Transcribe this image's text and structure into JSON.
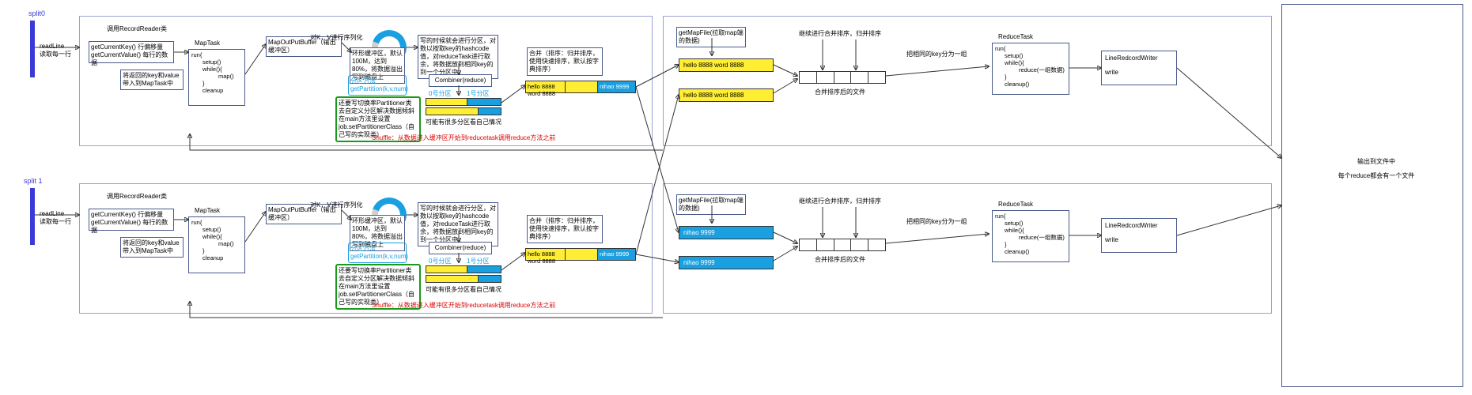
{
  "split0": {
    "label": "split0",
    "readLine1": "readLine",
    "readLine2": "读取每一行"
  },
  "split1": {
    "label": "split 1",
    "readLine1": "readLine",
    "readLine2": "读取每一行"
  },
  "recordReader": {
    "title": "调用RecordReader类",
    "getCurrentKey": "getCurrentKey()  行偏移量",
    "getCurrentValue": "getCurrentValue()  每行的数据",
    "pass": "将返回的key和value带入到MapTask中"
  },
  "mapTask": {
    "title": "MapTask",
    "runHead": "run{",
    "setup": "setup()",
    "while": "while(){",
    "map": "map()",
    "close": "}",
    "cleanup": "cleanup"
  },
  "buffer": {
    "title": "MapOutPutBuffer（输出缓冲区）",
    "serialize": "对K，V进行序列化",
    "ring1": "环形缓冲区，默认100M，达到80%，将数据溢出写到磁盘上"
  },
  "partitioner": {
    "blueTitle": "分区方法",
    "getPart": "getPartition(k,v,num)",
    "greenNote": "还要写切换率Partitioner类去自定义分区解决数据倾斜在main方法里设置 job.setPartitionerClass（自己写的实现类）"
  },
  "writePartition": "写的时候就会进行分区，对数以按取key的hashcode值，对reduceTask进行取余，将数据放到相同key的到一个分区中。",
  "combiner": "Combiner(reduce)",
  "partLabels": {
    "p0": "0号分区",
    "p1": "1号分区"
  },
  "multiFileNote": "可能有很多分区看自己情况",
  "mergeSort": {
    "box": "合并（排序：归并排序，使用快速排序，默认按字典排序）",
    "row1": "hello 8888  word 8888",
    "row2": "nihao 9999"
  },
  "shuffleNote": "Shuffle：从数据进入缓冲区开始到reducetask调用reduce方法之前",
  "reduceFetch": {
    "get": "getMapFile(拉取map端的数据)",
    "mergeNote": "继续进行合并排序，归并排序",
    "r1a": "hello 8888  word 8888",
    "r1b": "hello 8888  word 8888",
    "r2a": "nihao 9999",
    "r2b": "nihao 9999",
    "segNote": "合并排序后的文件",
    "group": "把相同的key分为一组"
  },
  "reduceTask": {
    "title": "ReduceTask",
    "runHead": "run{",
    "setup": "setup()",
    "while": "while(){",
    "reduce": "reduce(一组数据)",
    "close": "}",
    "cleanup": "cleanup()"
  },
  "writer": {
    "title": "LineRedcordWriter",
    "write": "write"
  },
  "output": {
    "line1": "输出到文件中",
    "line2": "每个reduce都会有一个文件"
  }
}
